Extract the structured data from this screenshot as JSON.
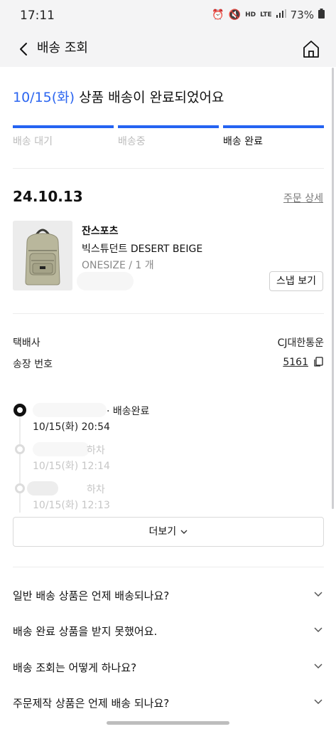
{
  "status_bar": {
    "time": "17:11",
    "network_hd": "HD",
    "network_lte": "LTE",
    "battery": "73%"
  },
  "header": {
    "title": "배송 조회",
    "back_icon": "chevron-left-icon",
    "home_icon": "home-icon"
  },
  "headline": {
    "date": "10/15(화)",
    "message": "상품 배송이 완료되었어요"
  },
  "progress": {
    "steps": [
      "배송 대기",
      "배송중",
      "배송 완료"
    ],
    "active_step": 2,
    "accent": "#2463f2"
  },
  "order": {
    "date": "24.10.13",
    "detail_link": "주문 상세",
    "product": {
      "brand": "잔스포츠",
      "name": "빅스튜던트 DESERT BEIGE",
      "option": "ONESIZE / 1 개",
      "snap_button": "스냅 보기"
    }
  },
  "shipping": {
    "courier_label": "택배사",
    "courier": "CJ대한통운",
    "tracking_label": "송장 번호",
    "tracking_number": "5161"
  },
  "timeline": [
    {
      "status": "· 배송완료",
      "time": "10/15(화) 20:54"
    },
    {
      "status": "하차",
      "time": "10/15(화) 12:14"
    },
    {
      "status": "하차",
      "time": "10/15(화) 12:13"
    }
  ],
  "more_button": "더보기",
  "faq": [
    "일반 배송 상품은 언제 배송되나요?",
    "배송 완료 상품을 받지 못했어요.",
    "배송 조회는 어떻게 하나요?",
    "주문제작 상품은 언제 배송 되나요?"
  ]
}
